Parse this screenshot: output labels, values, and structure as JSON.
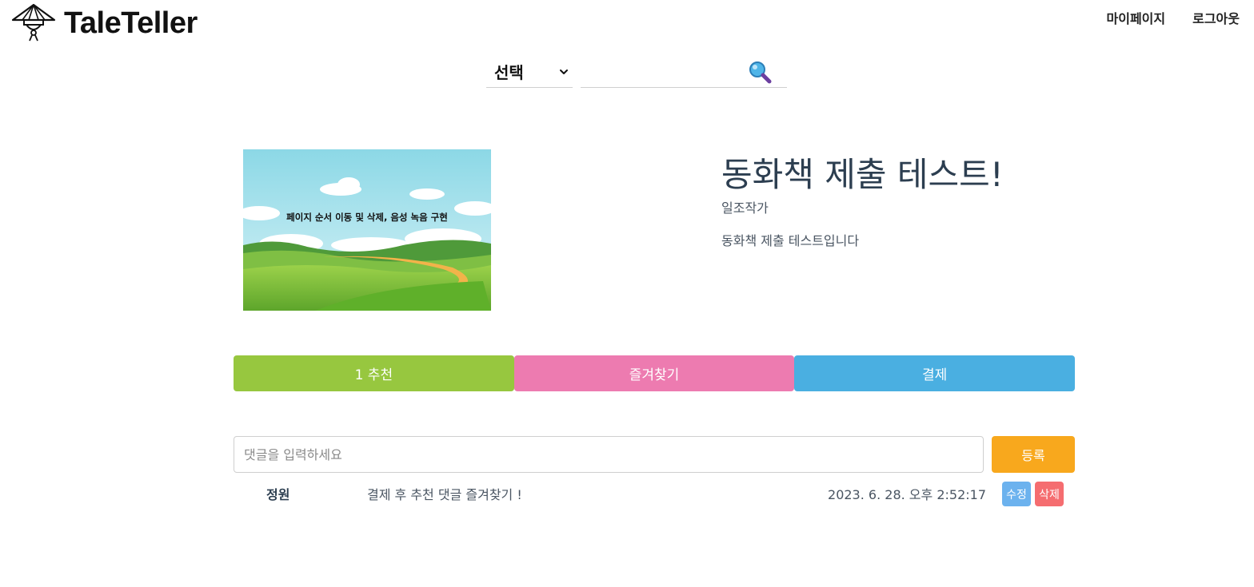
{
  "header": {
    "logo_text": "TaleTeller",
    "nav": {
      "mypage": "마이페이지",
      "logout": "로그아웃"
    }
  },
  "search": {
    "select_label": "선택",
    "query": "",
    "placeholder": ""
  },
  "book": {
    "cover_caption": "페이지 순서 이동 및 삭제, 음성 녹음 구현",
    "title": "동화책 제출 테스트!",
    "author": "일조작가",
    "description": "동화책 제출 테스트입니다"
  },
  "actions": {
    "like": "1 추천",
    "favorite": "즐겨찾기",
    "pay": "결제"
  },
  "comment_form": {
    "placeholder": "댓글을 입력하세요",
    "submit": "등록"
  },
  "comments": [
    {
      "author": "정원",
      "text": "결제 후 추천 댓글 즐겨찾기 !",
      "date": "2023. 6. 28. 오후 2:52:17",
      "edit": "수정",
      "delete": "삭제"
    }
  ],
  "colors": {
    "like": "#97c73f",
    "favorite": "#ed7bb0",
    "pay": "#4aafe1",
    "submit": "#f8a81d",
    "edit": "#6cb2ee",
    "delete": "#f56d70"
  },
  "icons": [
    "storyteller-hat-logo-icon",
    "chevron-down-icon",
    "magnifier-search-icon"
  ]
}
